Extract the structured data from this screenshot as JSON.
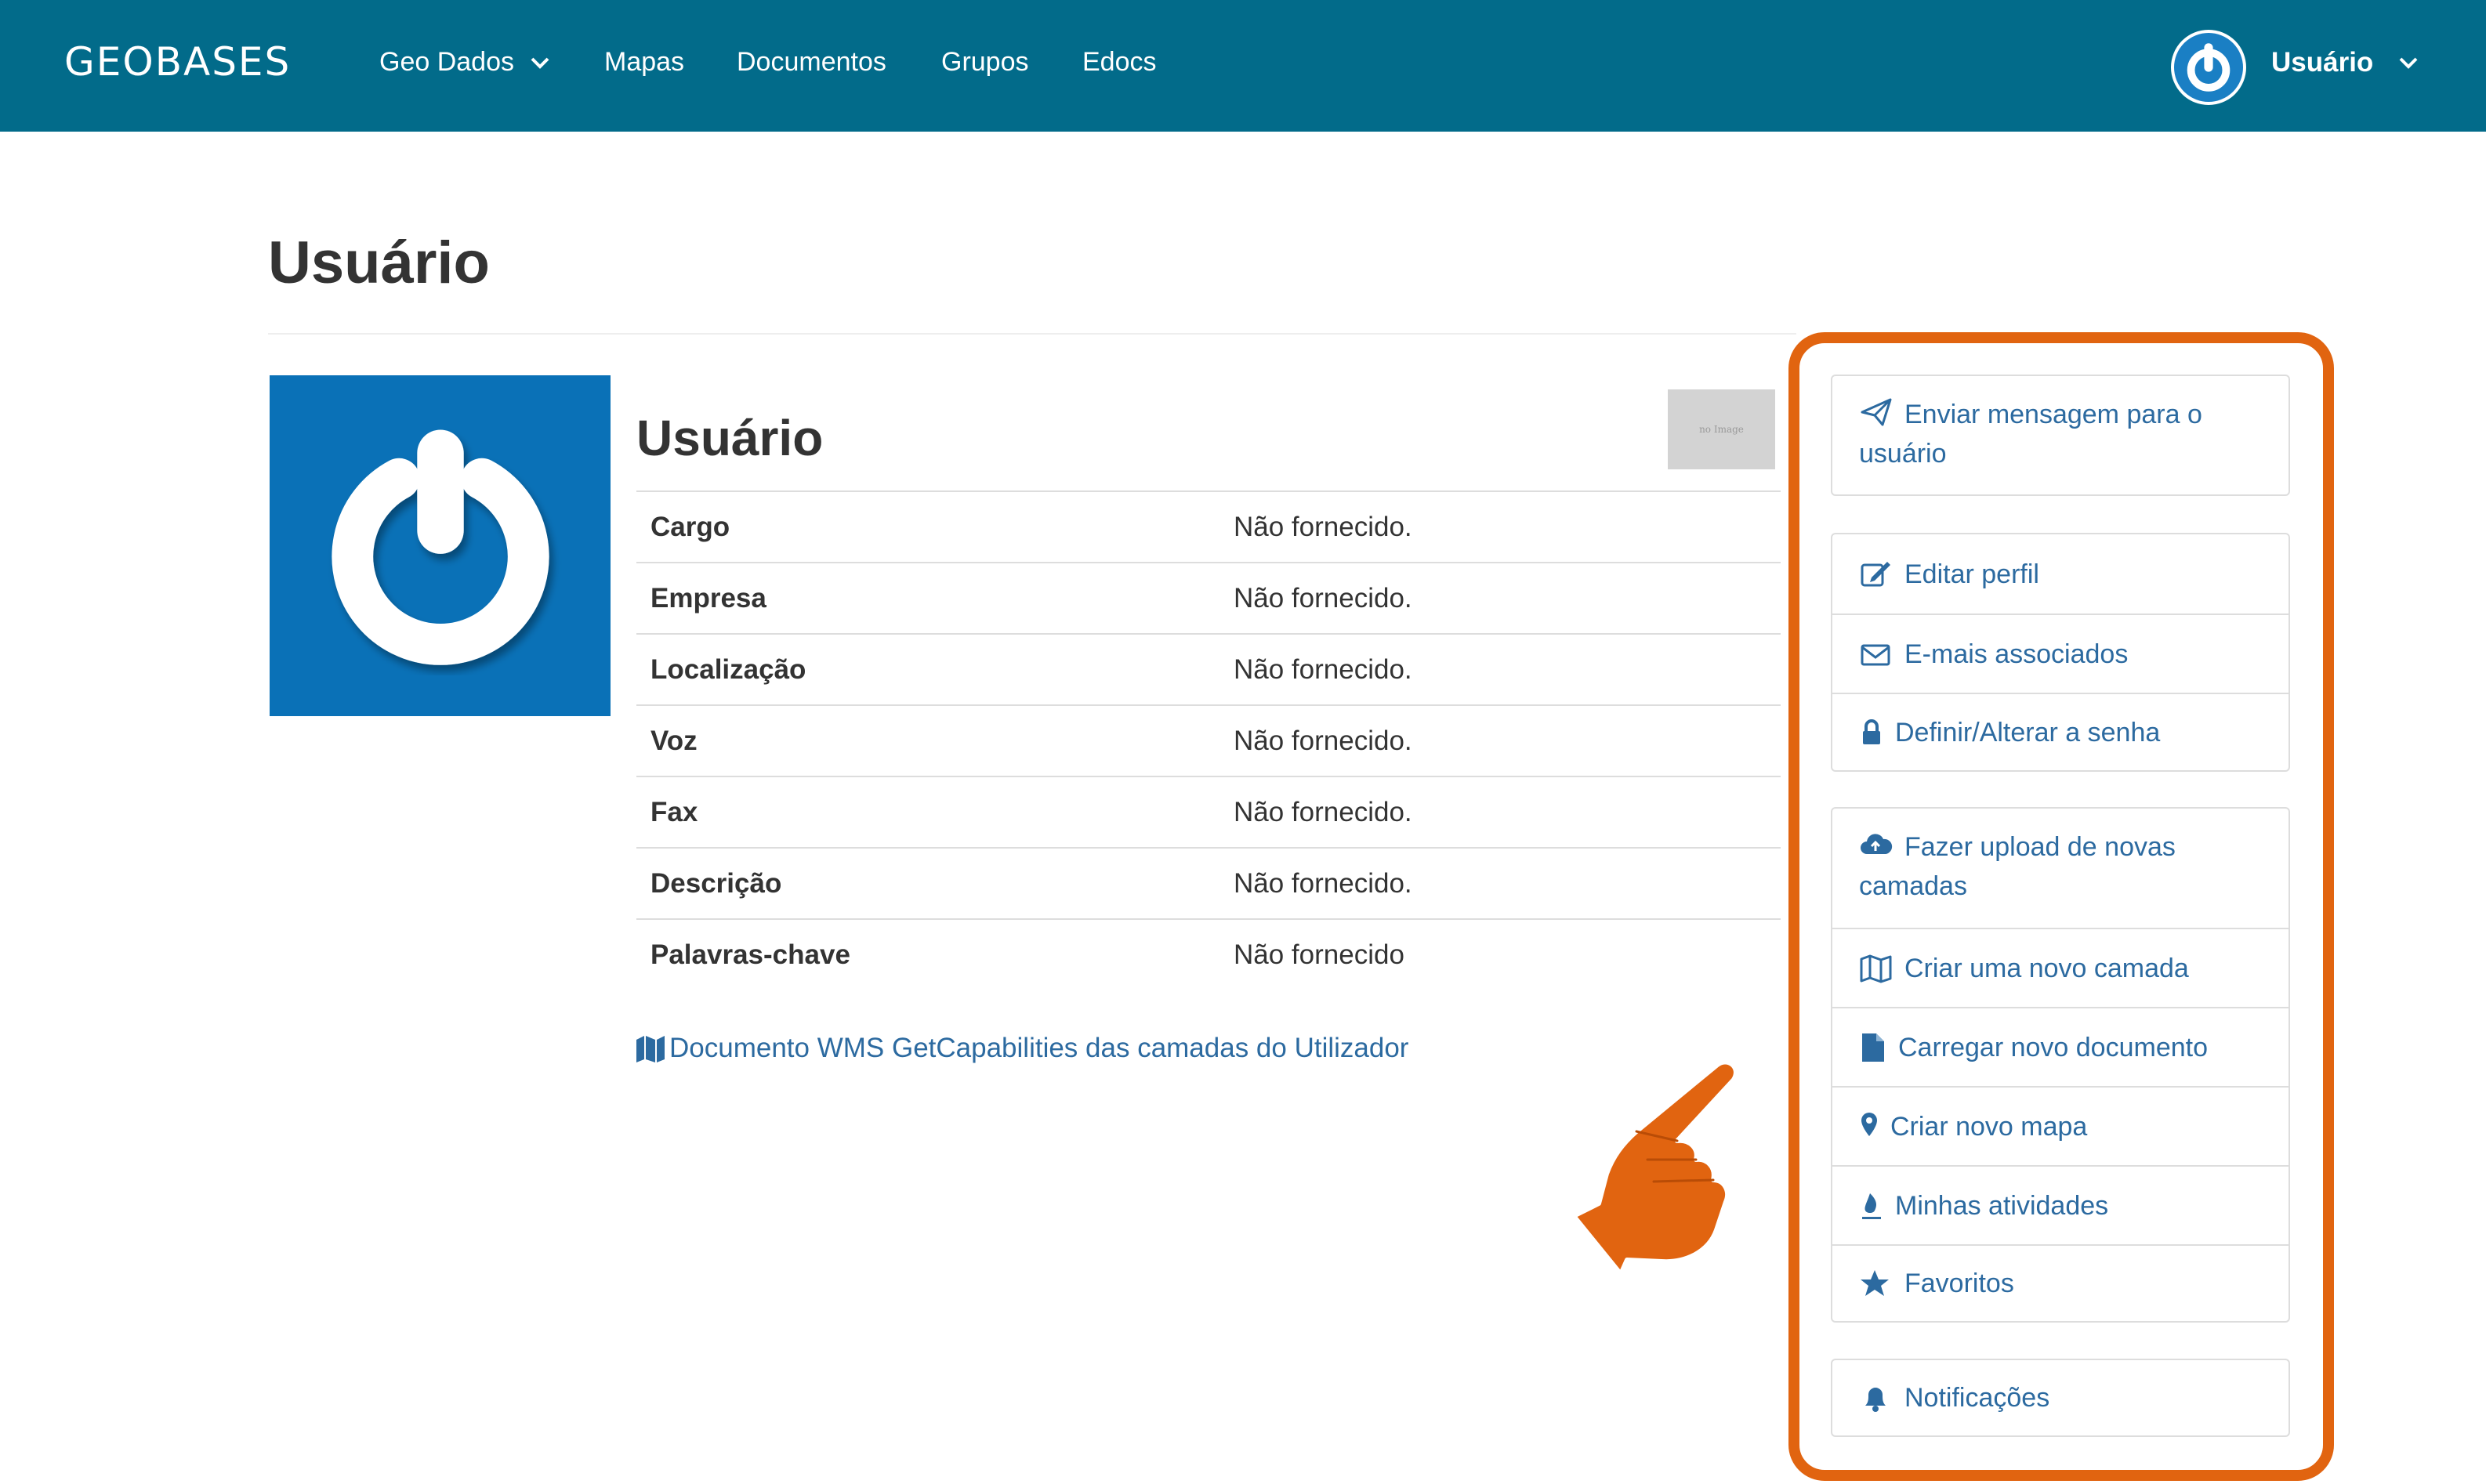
{
  "navbar": {
    "brand": "GEOBASES",
    "items": [
      {
        "label": "Geo Dados",
        "has_dropdown": true
      },
      {
        "label": "Mapas"
      },
      {
        "label": "Documentos"
      },
      {
        "label": "Grupos"
      },
      {
        "label": "Edocs"
      }
    ],
    "user_label": "Usuário",
    "background_color": "#026b8a"
  },
  "page": {
    "title": "Usuário"
  },
  "profile": {
    "name": "Usuário",
    "no_image_label": "no Image",
    "fields": [
      {
        "key": "Cargo",
        "value": "Não fornecido."
      },
      {
        "key": "Empresa",
        "value": "Não fornecido."
      },
      {
        "key": "Localização",
        "value": "Não fornecido."
      },
      {
        "key": "Voz",
        "value": "Não fornecido."
      },
      {
        "key": "Fax",
        "value": "Não fornecido."
      },
      {
        "key": "Descrição",
        "value": "Não fornecido."
      },
      {
        "key": "Palavras-chave",
        "value": "Não fornecido"
      }
    ],
    "wms_link": "Documento WMS GetCapabilities das camadas do Utilizador"
  },
  "sidebar": {
    "highlight_color": "#e16410",
    "link_color": "#2c6aa0",
    "groups": [
      [
        {
          "label": "Enviar mensagem para o usuário",
          "icon": "paper-plane-icon"
        }
      ],
      [
        {
          "label": "Editar perfil",
          "icon": "edit-icon"
        },
        {
          "label": "E-mais associados",
          "icon": "envelope-icon"
        },
        {
          "label": "Definir/Alterar a senha",
          "icon": "lock-icon"
        }
      ],
      [
        {
          "label": "Fazer upload de novas camadas",
          "icon": "cloud-upload-icon"
        },
        {
          "label": "Criar uma novo camada",
          "icon": "map-icon"
        },
        {
          "label": "Carregar novo documento",
          "icon": "file-icon"
        },
        {
          "label": "Criar novo mapa",
          "icon": "map-marker-icon"
        },
        {
          "label": "Minhas atividades",
          "icon": "fire-icon"
        },
        {
          "label": "Favoritos",
          "icon": "star-icon"
        }
      ],
      [
        {
          "label": "Notificações",
          "icon": "bell-icon"
        }
      ]
    ]
  },
  "annotation": {
    "pointer": "pointing-hand-icon",
    "pointer_color": "#e16410"
  }
}
